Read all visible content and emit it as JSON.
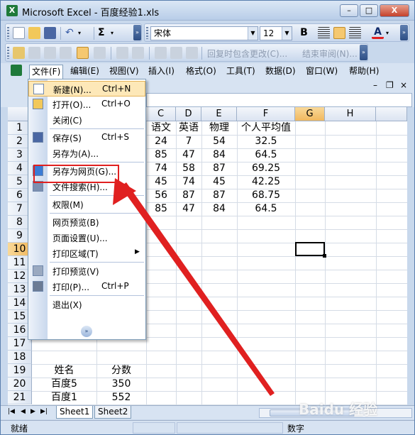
{
  "window": {
    "title": "Microsoft Excel - 百度经验1.xls",
    "app_icon": "X",
    "controls": {
      "minimize": "–",
      "maximize": "□",
      "close": "X"
    }
  },
  "toolbar": {
    "sum": "Σ",
    "font_name": "宋体",
    "font_size": "12",
    "bold": "B",
    "font_color": "A",
    "review_reply": "回复时包含更改(C)...",
    "end_review": "结束审阅(N)..."
  },
  "menubar": {
    "items": [
      "文件(F)",
      "编辑(E)",
      "视图(V)",
      "插入(I)",
      "格式(O)",
      "工具(T)",
      "数据(D)",
      "窗口(W)",
      "帮助(H)"
    ],
    "doc_controls": {
      "minimize": "–",
      "restore": "❐",
      "close": "×"
    }
  },
  "file_menu": {
    "items": [
      {
        "label": "新建(N)...",
        "shortcut": "Ctrl+N",
        "icon": "new-doc-icon",
        "hover": true
      },
      {
        "label": "打开(O)...",
        "shortcut": "Ctrl+O",
        "icon": "open-folder-icon"
      },
      {
        "label": "关闭(C)",
        "shortcut": ""
      },
      {
        "label": "保存(S)",
        "shortcut": "Ctrl+S",
        "icon": "save-disk-icon"
      },
      {
        "label": "另存为(A)...",
        "shortcut": ""
      },
      {
        "label": "另存为网页(G)...",
        "shortcut": "",
        "icon": "web-page-icon"
      },
      {
        "label": "文件搜索(H)...",
        "shortcut": "",
        "icon": "file-search-icon"
      },
      {
        "label": "权限(M)",
        "shortcut": ""
      },
      {
        "label": "网页预览(B)",
        "shortcut": ""
      },
      {
        "label": "页面设置(U)...",
        "shortcut": ""
      },
      {
        "label": "打印区域(T)",
        "shortcut": "",
        "submenu": true
      },
      {
        "label": "打印预览(V)",
        "shortcut": "",
        "icon": "print-preview-icon"
      },
      {
        "label": "打印(P)...",
        "shortcut": "Ctrl+P",
        "icon": "printer-icon"
      },
      {
        "label": "退出(X)",
        "shortcut": ""
      }
    ],
    "expand": "»"
  },
  "sheet": {
    "columns": [
      "C",
      "D",
      "E",
      "F",
      "G",
      "H"
    ],
    "selected_column": "G",
    "rows": [
      "1",
      "2",
      "3",
      "4",
      "5",
      "6",
      "7",
      "8",
      "9",
      "10",
      "11",
      "12",
      "13",
      "14",
      "15",
      "16",
      "17",
      "18",
      "19",
      "20",
      "21"
    ],
    "selected_row": "10",
    "header_row": [
      "语文",
      "英语",
      "物理",
      "个人平均值"
    ],
    "data_rows": [
      [
        "24",
        "7",
        "54",
        "32.5"
      ],
      [
        "85",
        "47",
        "84",
        "64.5"
      ],
      [
        "74",
        "58",
        "87",
        "69.25"
      ],
      [
        "45",
        "74",
        "45",
        "42.25"
      ],
      [
        "56",
        "87",
        "87",
        "68.75"
      ],
      [
        "85",
        "47",
        "84",
        "64.5"
      ]
    ],
    "lower_header": [
      "姓名",
      "分数"
    ],
    "lower_rows": [
      [
        "百度5",
        "350"
      ],
      [
        "百度1",
        "552"
      ]
    ]
  },
  "tabs": {
    "nav": [
      "|◀",
      "◀",
      "▶",
      "▶|"
    ],
    "sheets": [
      "Sheet1",
      "Sheet2"
    ]
  },
  "status": {
    "left": "就绪",
    "mode": "数字"
  },
  "watermark": "Baidu 经验",
  "colors": {
    "highlight_box": "#e02020",
    "arrow": "#e02020",
    "menu_hover": "#fde8b8",
    "selected_header": "#f1b85e"
  }
}
